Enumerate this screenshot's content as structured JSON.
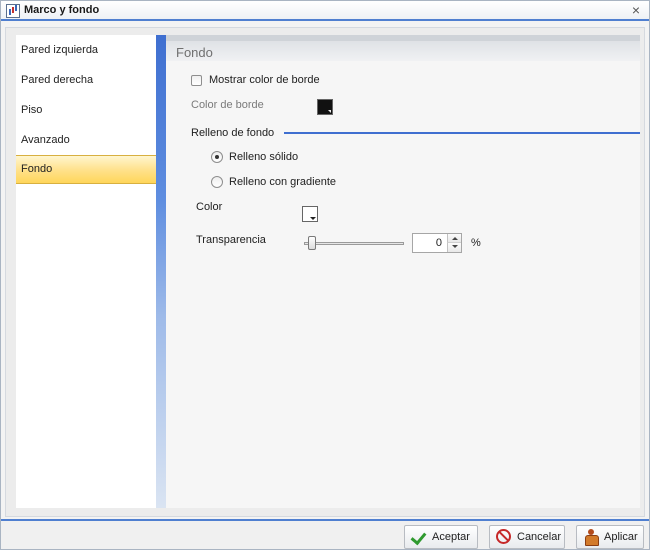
{
  "window": {
    "title": "Marco y fondo",
    "close_symbol": "×",
    "icon": "chart-icon"
  },
  "nav": {
    "items": [
      {
        "label": "Pared izquierda",
        "active": false
      },
      {
        "label": "Pared derecha",
        "active": false
      },
      {
        "label": "Piso",
        "active": false
      },
      {
        "label": "Avanzado",
        "active": false
      },
      {
        "label": "Fondo",
        "active": true
      }
    ]
  },
  "panel": {
    "title": "Fondo",
    "show_border_label": "Mostrar color de borde",
    "show_border_checked": false,
    "border_color_label": "Color de borde",
    "border_color": "#111111",
    "fill_section_label": "Relleno de fondo",
    "fill_options": [
      {
        "label": "Relleno sólido",
        "selected": true
      },
      {
        "label": "Relleno con gradiente",
        "selected": false
      }
    ],
    "color_label": "Color",
    "fill_color": "#ffffff",
    "transparency_label": "Transparencia",
    "transparency_value": "0",
    "transparency_unit": "%"
  },
  "footer": {
    "accept_label": "Aceptar",
    "cancel_label": "Cancelar",
    "apply_label": "Aplicar"
  },
  "colors": {
    "accent": "#3f6fd0",
    "active_item": "#ffd65a"
  }
}
